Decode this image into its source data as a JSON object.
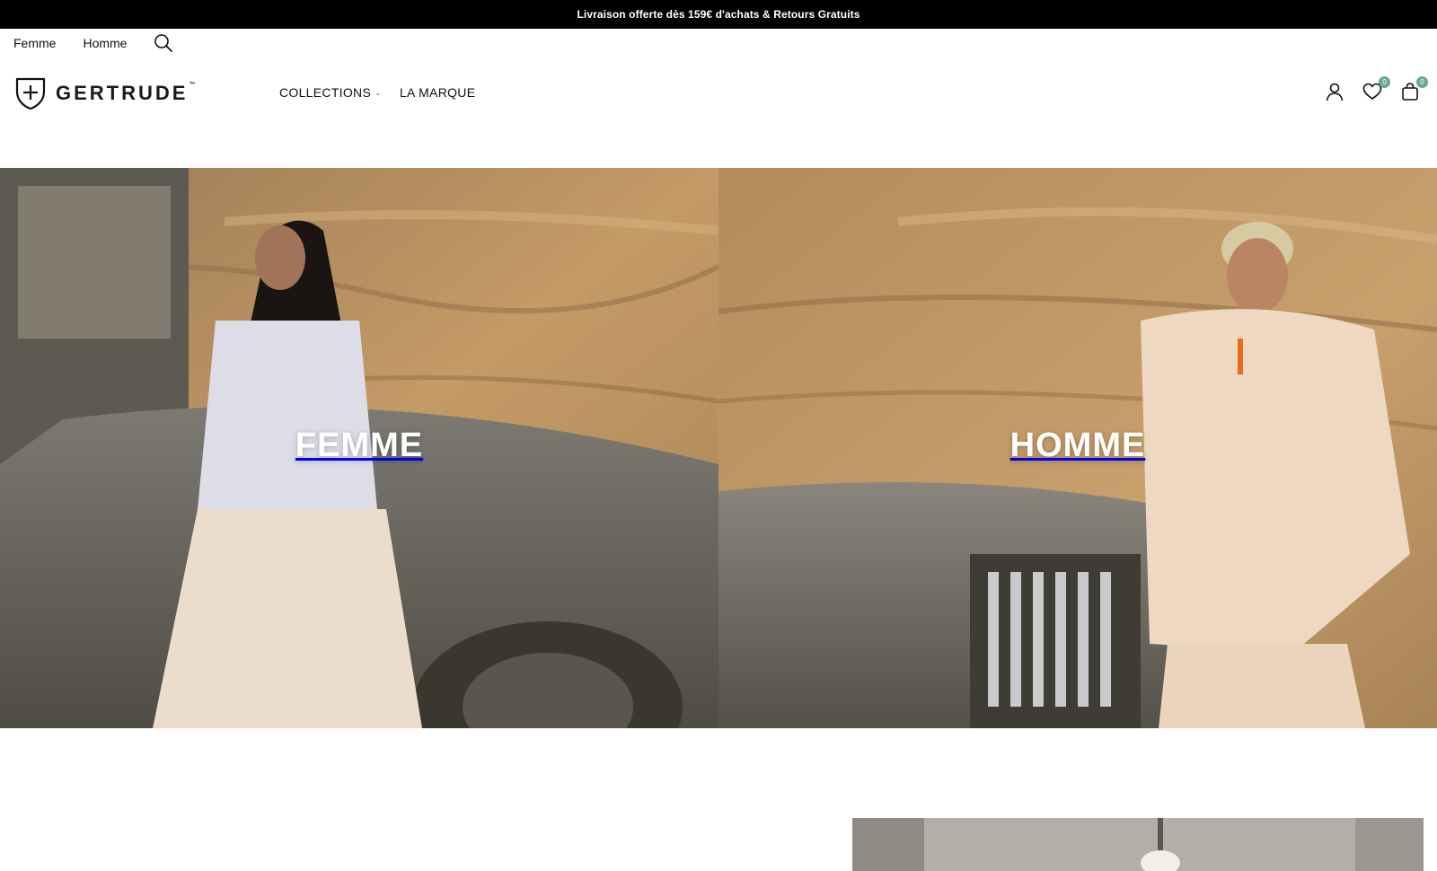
{
  "announcement": {
    "text": "Livraison offerte dès 159€ d'achats & Retours Gratuits"
  },
  "topnav": {
    "links": [
      "Femme",
      "Homme"
    ],
    "search_icon": "search-icon"
  },
  "header": {
    "logo_text": "GERTRUDE",
    "logo_tm": "™",
    "nav": [
      {
        "label": "COLLECTIONS",
        "has_dropdown": true
      },
      {
        "label": "LA MARQUE",
        "has_dropdown": false
      }
    ],
    "icons": {
      "account": "user-icon",
      "wishlist": "heart-icon",
      "cart": "bag-icon"
    },
    "wishlist_count": "0",
    "cart_count": "0"
  },
  "hero": {
    "panels": [
      {
        "title": "FEMME"
      },
      {
        "title": "HOMME"
      }
    ]
  },
  "colors": {
    "announcement_bg": "#000000",
    "badge": "#6aa88c",
    "sand": "#b8905e",
    "jeep": "#6d6a60"
  }
}
